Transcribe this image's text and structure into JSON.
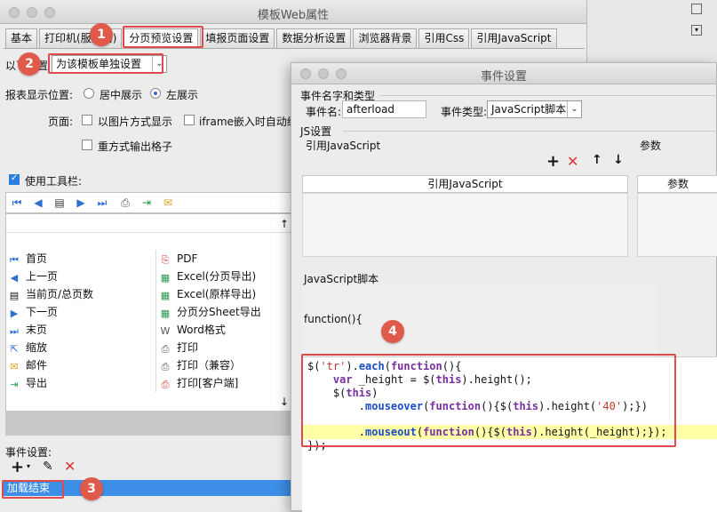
{
  "back_window": {
    "title": "模板Web属性",
    "tabs": [
      "基本",
      "打印机(服务器)",
      "分页预览设置",
      "填报页面设置",
      "数据分析设置",
      "浏览器背景",
      "引用Css",
      "引用JavaScript"
    ],
    "setting_prefix": "以下设置",
    "setting_select": "为该模板单独设置",
    "report_position_label": "报表显示位置:",
    "position_center": "居中展示",
    "position_left": "左展示",
    "page_label": "页面:",
    "opt_image_display": "以图片方式显示",
    "opt_iframe": "iframe嵌入时自动约",
    "opt_repeat_grid": "重方式输出格子",
    "use_toolbar_label": "使用工具栏:",
    "toolbar_items_left": [
      "首页",
      "上一页",
      "当前页/总页数",
      "下一页",
      "末页",
      "缩放",
      "邮件",
      "导出"
    ],
    "toolbar_items_right": [
      "PDF",
      "Excel(分页导出)",
      "Excel(原样导出)",
      "分页分Sheet导出",
      "Word格式",
      "打印",
      "打印（兼容）",
      "打印[客户端]"
    ],
    "event_settings_label": "事件设置:",
    "event_item": "加载结束"
  },
  "dialog": {
    "title": "事件设置",
    "group_name_type": "事件名字和类型",
    "event_name_label": "事件名:",
    "event_name_value": "afterload",
    "event_type_label": "事件类型:",
    "event_type_value": "JavaScript脚本",
    "js_settings": "JS设置",
    "ref_js_label": "引用JavaScript",
    "params_label": "参数",
    "col_ref_js": "引用JavaScript",
    "col_params": "参数",
    "js_script_label": "JavaScript脚本",
    "function_header": "function(){",
    "code_lines": [
      "$('tr').each(function(){",
      "    var _height = $(this).height();",
      "    $(this)",
      "        .mouseover(function(){$(this).height('40');})",
      "        .mouseout(function(){$(this).height(_height);});",
      "});"
    ]
  },
  "badges": [
    "1",
    "2",
    "3",
    "4"
  ],
  "colors": {
    "accent": "#3d8ee6",
    "annotation": "#e04a4a",
    "highlight": "#ffffa8"
  }
}
